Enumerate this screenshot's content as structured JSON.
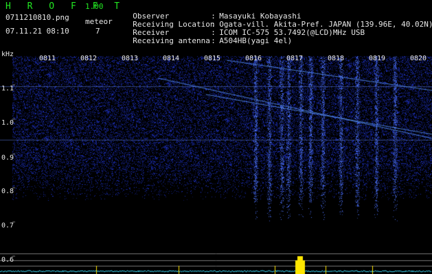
{
  "app": {
    "name": "H R O F F T",
    "version": "1.00"
  },
  "file": {
    "name": "0711210810.png",
    "datetime": "07.11.21 08:10"
  },
  "meteor": {
    "label": "meteor",
    "count": "7"
  },
  "info": [
    {
      "label": "Observer",
      "value": "Masayuki Kobayashi"
    },
    {
      "label": "Receiving Location",
      "value": "Ogata-vill. Akita-Pref. JAPAN (139.96E, 40.02N)"
    },
    {
      "label": "Receiver",
      "value": "ICOM IC-575 53.7492(@LCD)MHz USB"
    },
    {
      "label": "Receiving antenna",
      "value": "A504HB(yagi 4el)"
    }
  ],
  "axes": {
    "y_unit": "kHz",
    "y_ticks": [
      "1.1",
      "1.0",
      "0.9",
      "0.8",
      "0.7",
      "0.6"
    ],
    "x_ticks": [
      "0811",
      "0812",
      "0813",
      "0814",
      "0815",
      "0816",
      "0817",
      "0818",
      "0819",
      "0820"
    ]
  },
  "colors": {
    "accent_green": "#22e822",
    "signal_blue": "#3a6cff",
    "echo_yellow": "#ffe600",
    "trace_cyan": "#40e0ff"
  }
}
